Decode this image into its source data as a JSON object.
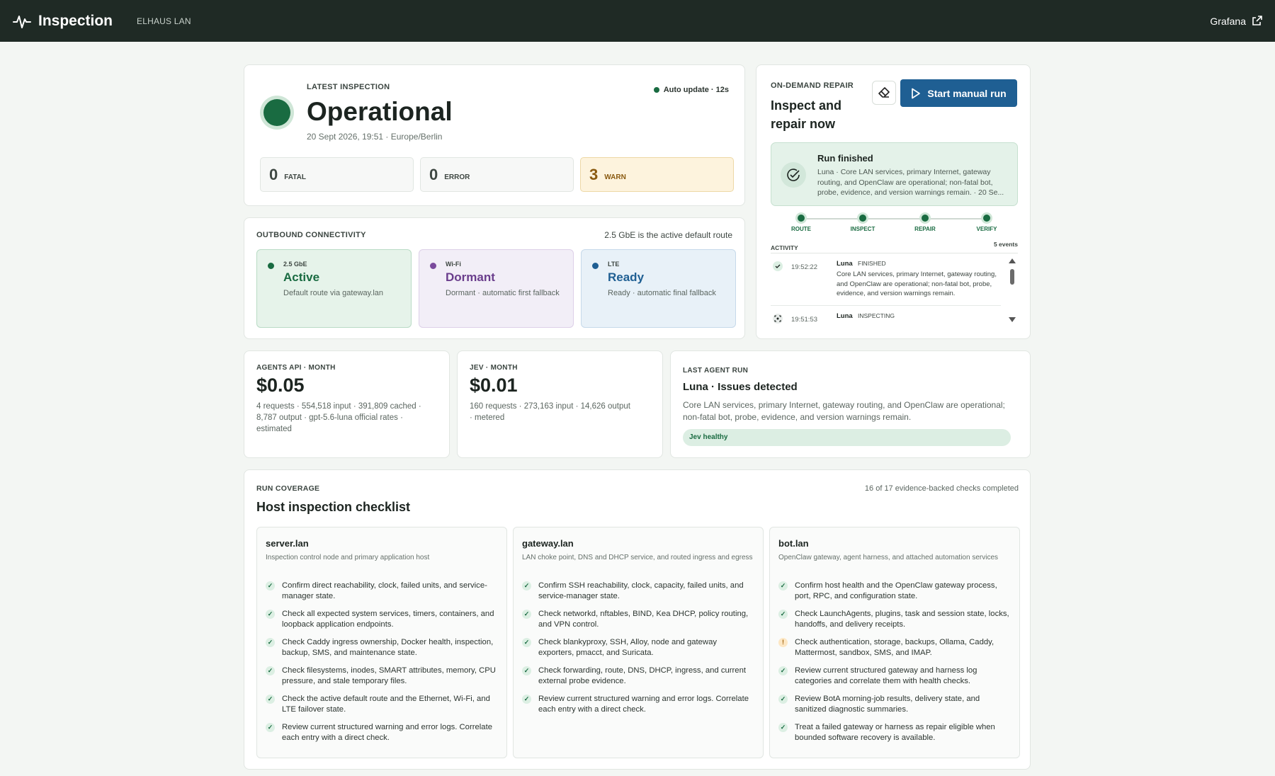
{
  "topbar": {
    "title": "Inspection",
    "subtitle": "ELHAUS LAN",
    "grafana": "Grafana"
  },
  "latest": {
    "caption": "LATEST INSPECTION",
    "status": "Operational",
    "timestamp": "20 Sept 2026, 19:51 · Europe/Berlin",
    "auto_update": "Auto update · 12s",
    "counters": [
      {
        "count": "0",
        "label": "FATAL"
      },
      {
        "count": "0",
        "label": "ERROR"
      },
      {
        "count": "3",
        "label": "WARN"
      }
    ]
  },
  "outbound": {
    "caption": "OUTBOUND CONNECTIVITY",
    "summary": "2.5 GbE is the active default route",
    "routes": [
      {
        "kind": "2.5 GbE",
        "state": "Active",
        "detail": "Default route via gateway.lan",
        "color": "#196b41"
      },
      {
        "kind": "Wi-Fi",
        "state": "Dormant",
        "detail": "Dormant · automatic first fallback",
        "color": "#7a4a9c"
      },
      {
        "kind": "LTE",
        "state": "Ready",
        "detail": "Ready · automatic final fallback",
        "color": "#1f5f93"
      }
    ]
  },
  "repair": {
    "caption": "ON-DEMAND REPAIR",
    "title_line1": "Inspect and",
    "title_line2": "repair now",
    "start_label": "Start manual run",
    "finished_title": "Run finished",
    "finished_text": "Luna · Core LAN services, primary Internet, gateway routing, and OpenClaw are operational; non-fatal bot, probe, evidence, and version warnings remain. · 20 Se...",
    "steps": [
      "ROUTE",
      "INSPECT",
      "REPAIR",
      "VERIFY"
    ],
    "activity_label": "ACTIVITY",
    "activity_count": "5 events",
    "events": [
      {
        "time": "19:52:22",
        "agent": "Luna",
        "status": "FINISHED",
        "text": "Core LAN services, primary Internet, gateway routing, and OpenClaw are operational; non-fatal bot, probe, evidence, and version warnings remain."
      },
      {
        "time": "19:51:53",
        "agent": "Luna",
        "status": "INSPECTING",
        "text": ""
      }
    ]
  },
  "api": {
    "caption": "AGENTS API · MONTH",
    "amount": "$0.05",
    "detail": "4 requests · 554,518 input · 391,809 cached · 8,787 output · gpt-5.6-luna official rates · estimated"
  },
  "jev": {
    "caption": "JEV · MONTH",
    "amount": "$0.01",
    "detail": "160 requests · 273,163 input · 14,626 output · metered"
  },
  "lastrun": {
    "caption": "LAST AGENT RUN",
    "title": "Luna · Issues detected",
    "text": "Core LAN services, primary Internet, gateway routing, and OpenClaw are operational; non-fatal bot, probe, evidence, and version warnings remain.",
    "badge": "Jev healthy"
  },
  "coverage": {
    "caption": "RUN COVERAGE",
    "title": "Host inspection checklist",
    "summary": "16 of 17 evidence-backed checks completed",
    "hosts": [
      {
        "name": "server.lan",
        "desc": "Inspection control node and primary application host",
        "checks": [
          {
            "ok": true,
            "text": "Confirm direct reachability, clock, failed units, and service-manager state."
          },
          {
            "ok": true,
            "text": "Check all expected system services, timers, containers, and loopback application endpoints."
          },
          {
            "ok": true,
            "text": "Check Caddy ingress ownership, Docker health, inspection, backup, SMS, and maintenance state."
          },
          {
            "ok": true,
            "text": "Check filesystems, inodes, SMART attributes, memory, CPU pressure, and stale temporary files."
          },
          {
            "ok": true,
            "text": "Check the active default route and the Ethernet, Wi-Fi, and LTE failover state."
          },
          {
            "ok": true,
            "text": "Review current structured warning and error logs. Correlate each entry with a direct check."
          }
        ]
      },
      {
        "name": "gateway.lan",
        "desc": "LAN choke point, DNS and DHCP service, and routed ingress and egress",
        "checks": [
          {
            "ok": true,
            "text": "Confirm SSH reachability, clock, capacity, failed units, and service-manager state."
          },
          {
            "ok": true,
            "text": "Check networkd, nftables, BIND, Kea DHCP, policy routing, and VPN control."
          },
          {
            "ok": true,
            "text": "Check blankyproxy, SSH, Alloy, node and gateway exporters, pmacct, and Suricata."
          },
          {
            "ok": true,
            "text": "Check forwarding, route, DNS, DHCP, ingress, and current external probe evidence."
          },
          {
            "ok": true,
            "text": "Review current structured warning and error logs. Correlate each entry with a direct check."
          }
        ]
      },
      {
        "name": "bot.lan",
        "desc": "OpenClaw gateway, agent harness, and attached automation services",
        "checks": [
          {
            "ok": true,
            "text": "Confirm host health and the OpenClaw gateway process, port, RPC, and configuration state."
          },
          {
            "ok": true,
            "text": "Check LaunchAgents, plugins, task and session state, locks, handoffs, and delivery receipts."
          },
          {
            "ok": false,
            "text": "Check authentication, storage, backups, Ollama, Caddy, Mattermost, sandbox, SMS, and IMAP."
          },
          {
            "ok": true,
            "text": "Review current structured gateway and harness log categories and correlate them with health checks."
          },
          {
            "ok": true,
            "text": "Review BotA morning-job results, delivery state, and sanitized diagnostic summaries."
          },
          {
            "ok": true,
            "text": "Treat a failed gateway or harness as repair eligible when bounded software recovery is available."
          }
        ]
      }
    ]
  }
}
